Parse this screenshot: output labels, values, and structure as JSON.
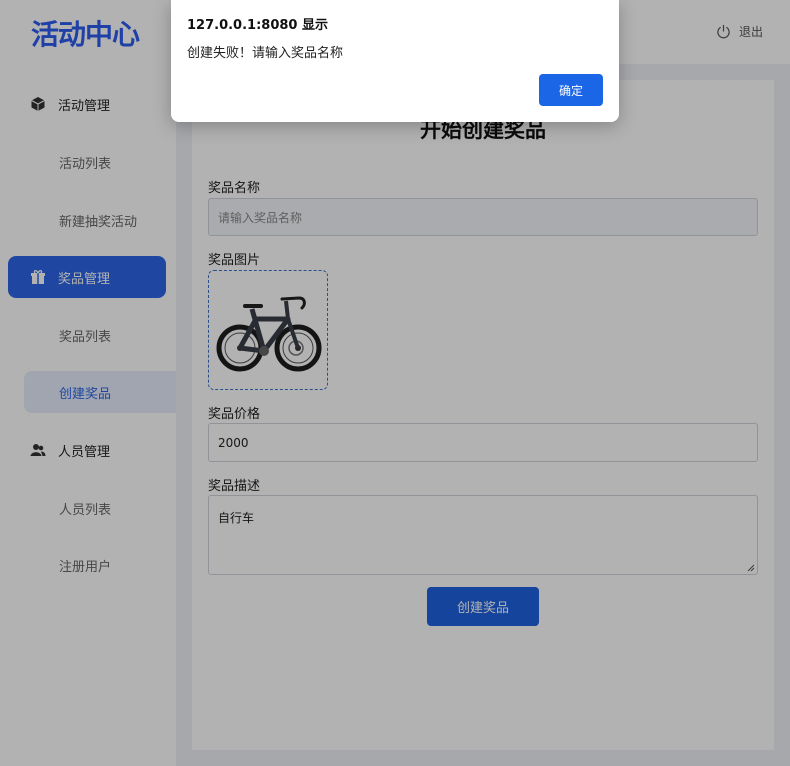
{
  "header": {
    "logo": "活动中心",
    "logout_label": "退出"
  },
  "sidebar": {
    "groups": [
      {
        "label": "活动管理",
        "icon": "cube-icon",
        "active": false,
        "items": [
          {
            "label": "活动列表"
          },
          {
            "label": "新建抽奖活动"
          }
        ]
      },
      {
        "label": "奖品管理",
        "icon": "gift-icon",
        "active": true,
        "items": [
          {
            "label": "奖品列表"
          },
          {
            "label": "创建奖品",
            "active": true
          }
        ]
      },
      {
        "label": "人员管理",
        "icon": "users-icon",
        "active": false,
        "items": [
          {
            "label": "人员列表"
          },
          {
            "label": "注册用户"
          }
        ]
      }
    ]
  },
  "form": {
    "title": "开始创建奖品",
    "name_label": "奖品名称",
    "name_placeholder": "请输入奖品名称",
    "name_value": "",
    "image_label": "奖品图片",
    "price_label": "奖品价格",
    "price_value": "2000",
    "desc_label": "奖品描述",
    "desc_value": "自行车",
    "submit_label": "创建奖品"
  },
  "dialog": {
    "title": "127.0.0.1:8080 显示",
    "message": "创建失败！请输入奖品名称",
    "ok_label": "确定"
  },
  "colors": {
    "accent": "#2d66e8",
    "overlay": "rgba(0,0,0,0.30)",
    "page_bg": "#eef1f6"
  }
}
